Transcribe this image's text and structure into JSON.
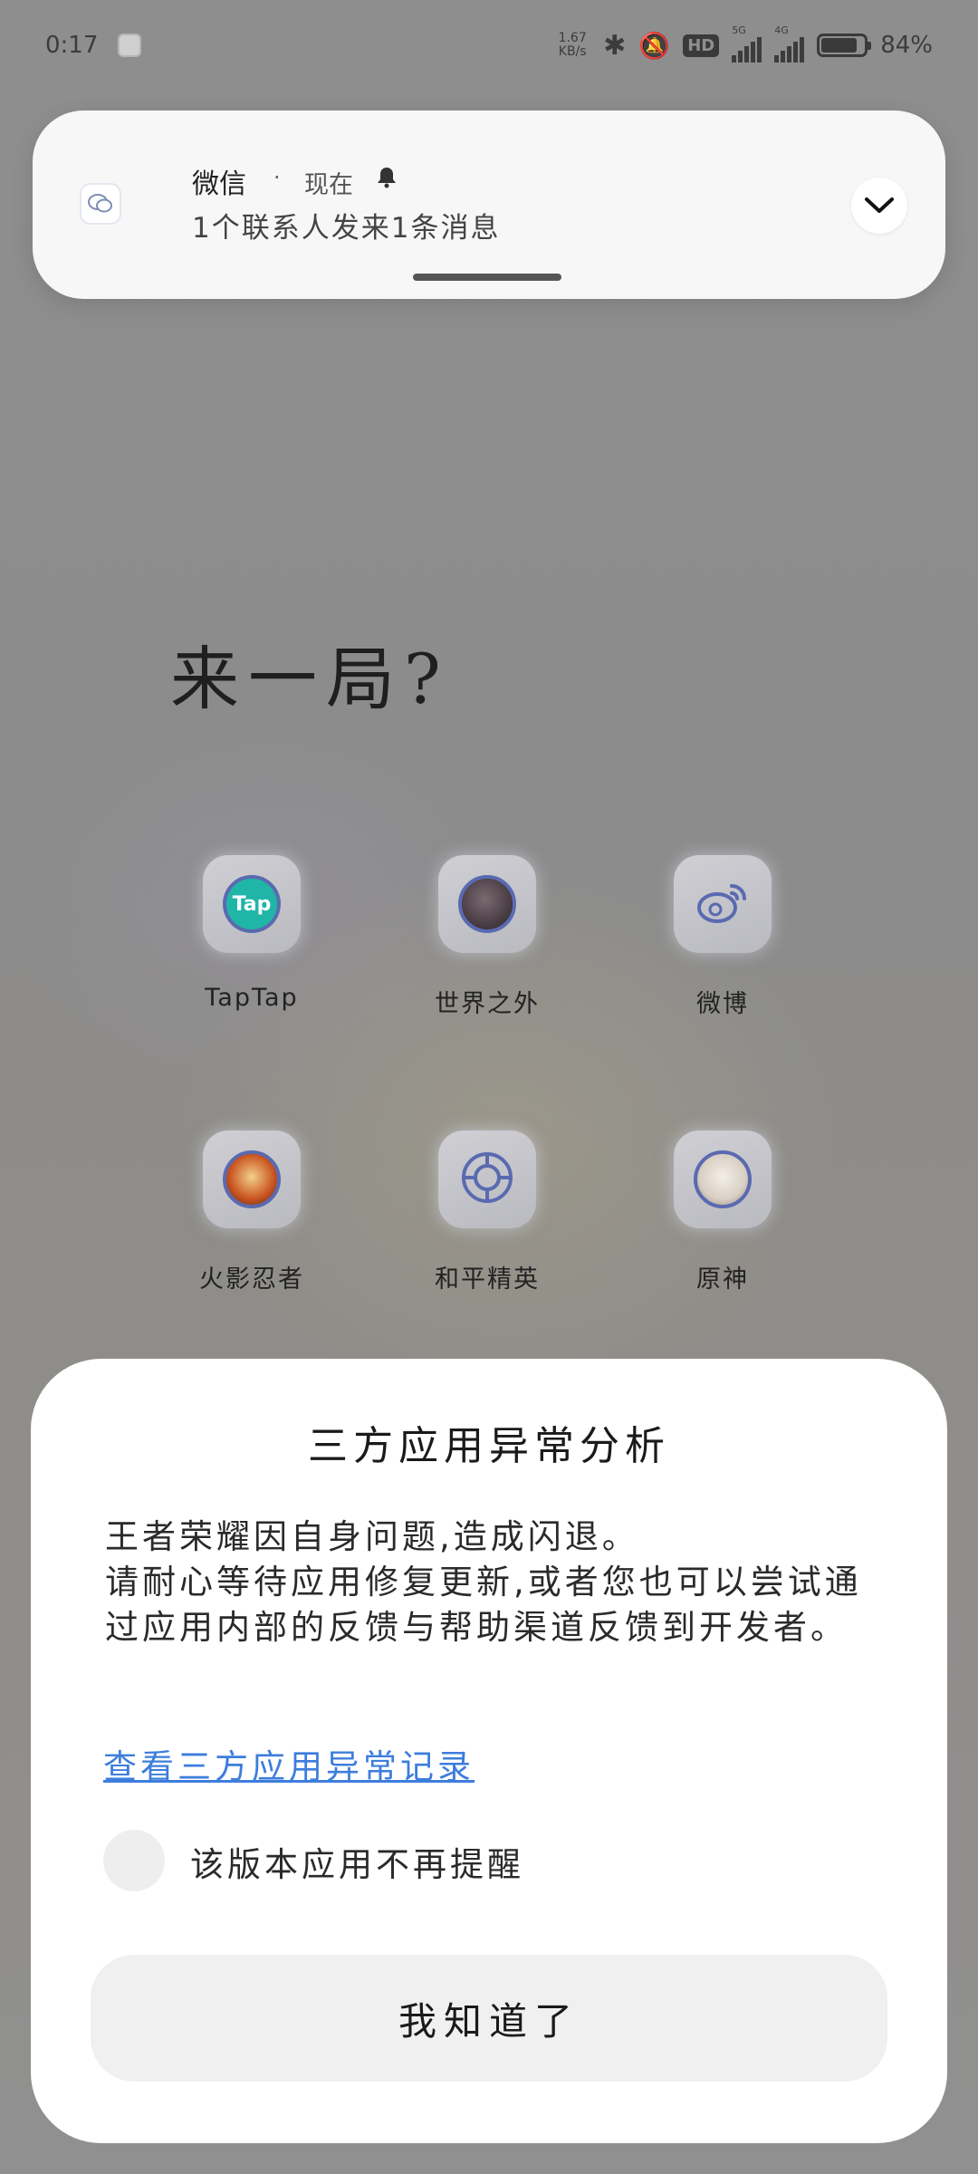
{
  "status_bar": {
    "time": "0:17",
    "net_speed": "1.67 KB/s",
    "hd_label": "HD",
    "sig1_label": "5G",
    "sig2_label": "4G",
    "battery": "84%",
    "battery_level": 0.84
  },
  "notification": {
    "app": "微信",
    "dot": "·",
    "time": "现在",
    "message": "1个联系人发来1条消息",
    "icons": [
      "wechat-icon",
      "bell-icon",
      "chevron-down-icon"
    ]
  },
  "folder": {
    "title": "来一局?",
    "apps": [
      {
        "label": "TapTap",
        "glyph": "Tap",
        "color": "#1fb6a8"
      },
      {
        "label": "世界之外",
        "glyph": "",
        "color": "#3a3040"
      },
      {
        "label": "微博",
        "glyph": "",
        "color": "#c8cbd8"
      },
      {
        "label": "火影忍者",
        "glyph": "",
        "color": "#d86a24"
      },
      {
        "label": "和平精英",
        "glyph": "",
        "color": "#c8cbd8"
      },
      {
        "label": "原神",
        "glyph": "",
        "color": "#e8e3dc"
      }
    ]
  },
  "dialog": {
    "title": "三方应用异常分析",
    "body_line1": "王者荣耀因自身问题,造成闪退。",
    "body_line2": "请耐心等待应用修复更新,或者您也可以尝试通过应用内部的反馈与帮助渠道反馈到开发者。",
    "link": "查看三方应用异常记录",
    "checkbox_label": "该版本应用不再提醒",
    "button": "我知道了"
  }
}
